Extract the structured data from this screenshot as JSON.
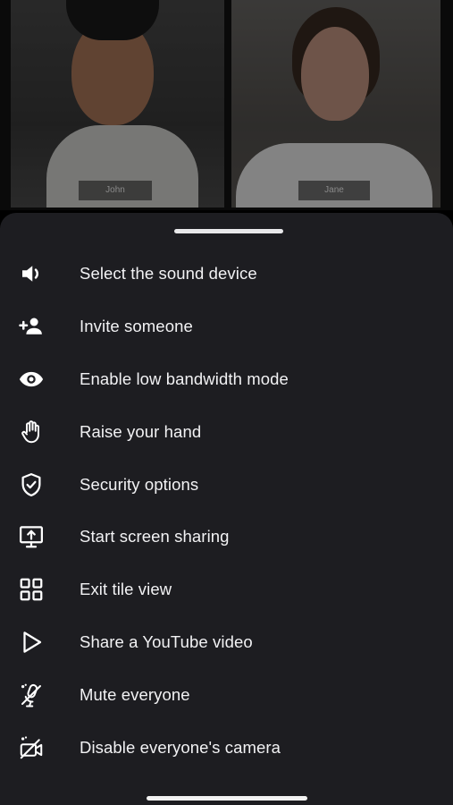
{
  "participants": [
    {
      "name": "John"
    },
    {
      "name": "Jane"
    }
  ],
  "menu": {
    "items": [
      {
        "label": "Select the sound device",
        "icon": "speaker-icon"
      },
      {
        "label": "Invite someone",
        "icon": "add-person-icon"
      },
      {
        "label": "Enable low bandwidth mode",
        "icon": "eye-icon"
      },
      {
        "label": "Raise your hand",
        "icon": "hand-icon"
      },
      {
        "label": "Security options",
        "icon": "shield-check-icon"
      },
      {
        "label": "Start screen sharing",
        "icon": "screen-share-icon"
      },
      {
        "label": "Exit tile view",
        "icon": "tile-grid-icon"
      },
      {
        "label": "Share a YouTube video",
        "icon": "play-icon"
      },
      {
        "label": "Mute everyone",
        "icon": "mic-off-icon"
      },
      {
        "label": "Disable everyone's camera",
        "icon": "camera-off-icon"
      }
    ]
  },
  "colors": {
    "sheet_background": "#1d1d21",
    "text": "#f2f2f4"
  }
}
